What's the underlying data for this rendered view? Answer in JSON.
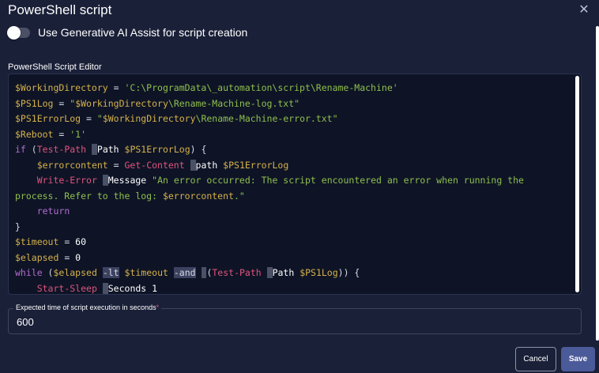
{
  "dialog": {
    "title": "PowerShell script",
    "close_label": "✕"
  },
  "ai_assist": {
    "label": "Use Generative AI Assist for script creation",
    "enabled": false
  },
  "editor": {
    "label": "PowerShell Script Editor",
    "lines": [
      [
        [
          "v",
          "$WorkingDirectory"
        ],
        [
          "o",
          " = "
        ],
        [
          "s",
          "'C:\\ProgramData\\_automation\\script\\Rename-Machine'"
        ]
      ],
      [
        [
          "v",
          "$PS1Log"
        ],
        [
          "o",
          " = "
        ],
        [
          "s",
          "\""
        ],
        [
          "v",
          "$WorkingDirectory"
        ],
        [
          "s",
          "\\Rename-Machine-log.txt\""
        ]
      ],
      [
        [
          "v",
          "$PS1ErrorLog"
        ],
        [
          "o",
          " = "
        ],
        [
          "s",
          "\""
        ],
        [
          "v",
          "$WorkingDirectory"
        ],
        [
          "s",
          "\\Rename-Machine-error.txt\""
        ]
      ],
      [
        [
          "v",
          "$Reboot"
        ],
        [
          "o",
          " = "
        ],
        [
          "s",
          "'1'"
        ]
      ],
      [
        [
          "k",
          "if"
        ],
        [
          "o",
          " ("
        ],
        [
          "c",
          "Test-Path"
        ],
        [
          "o",
          " "
        ],
        [
          "mark",
          "-"
        ],
        [
          "w",
          "Path "
        ],
        [
          "v",
          "$PS1ErrorLog"
        ],
        [
          "o",
          ") {"
        ]
      ],
      [
        [
          "o",
          "    "
        ],
        [
          "v",
          "$errorcontent"
        ],
        [
          "o",
          " = "
        ],
        [
          "c",
          "Get-Content"
        ],
        [
          "o",
          " "
        ],
        [
          "mark",
          "-"
        ],
        [
          "w",
          "path "
        ],
        [
          "v",
          "$PS1ErrorLog"
        ]
      ],
      [
        [
          "o",
          "    "
        ],
        [
          "c",
          "Write-Error"
        ],
        [
          "o",
          " "
        ],
        [
          "mark",
          "-"
        ],
        [
          "w",
          "Message "
        ],
        [
          "s",
          "\"An error occurred: The script encountered an error when running the"
        ]
      ],
      [
        [
          "s",
          "process. Refer to the log: "
        ],
        [
          "v",
          "$errorcontent"
        ],
        [
          "s",
          ".\""
        ]
      ],
      [
        [
          "o",
          "    "
        ],
        [
          "k",
          "return"
        ]
      ],
      [
        [
          "o",
          "}"
        ]
      ],
      [
        [
          "v",
          "$timeout"
        ],
        [
          "o",
          " = "
        ],
        [
          "w",
          "60"
        ]
      ],
      [
        [
          "v",
          "$elapsed"
        ],
        [
          "o",
          " = "
        ],
        [
          "w",
          "0"
        ]
      ],
      [
        [
          "k",
          "while"
        ],
        [
          "o",
          " ("
        ],
        [
          "v",
          "$elapsed"
        ],
        [
          "o",
          " "
        ],
        [
          "hl",
          "-lt"
        ],
        [
          "o",
          " "
        ],
        [
          "v",
          "$timeout"
        ],
        [
          "o",
          " "
        ],
        [
          "hl",
          "-and"
        ],
        [
          "o",
          " "
        ],
        [
          "mark",
          "-"
        ],
        [
          "o",
          "("
        ],
        [
          "c",
          "Test-Path"
        ],
        [
          "o",
          " "
        ],
        [
          "mark",
          "-"
        ],
        [
          "w",
          "Path "
        ],
        [
          "v",
          "$PS1Log"
        ],
        [
          "o",
          ")) {"
        ]
      ],
      [
        [
          "o",
          "    "
        ],
        [
          "c",
          "Start-Sleep"
        ],
        [
          "o",
          " "
        ],
        [
          "mark",
          "-"
        ],
        [
          "w",
          "Seconds 1"
        ]
      ]
    ]
  },
  "execution_time": {
    "label": "Expected time of script execution in seconds",
    "required_marker": "*",
    "value": "600"
  },
  "actions": {
    "cancel_label": "Cancel",
    "save_label": "Save"
  },
  "colors": {
    "background": "#1a2038",
    "editor_background": "#0e1426",
    "variable": "#d6b14a",
    "string": "#8fbf4d",
    "keyword": "#b36bd1",
    "cmdlet": "#e0537d",
    "save_button": "#4b5a99"
  }
}
